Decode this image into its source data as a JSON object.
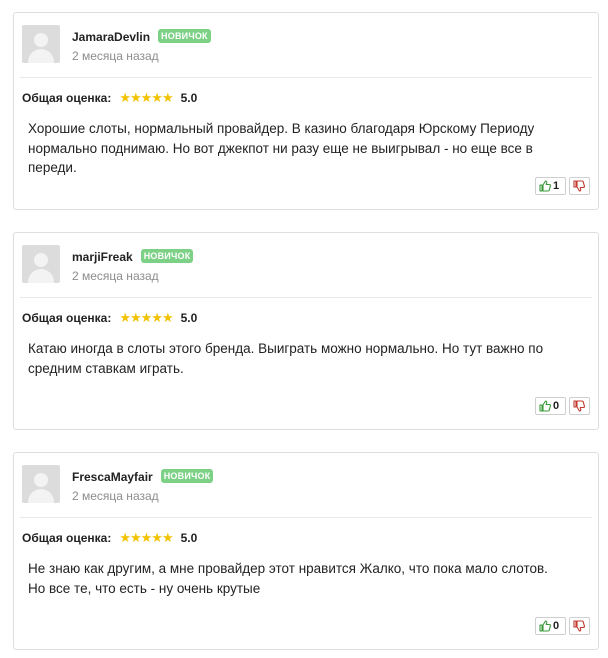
{
  "reviews": [
    {
      "username": "JamaraDevlin",
      "badge": "НОВИЧОК",
      "date": "2 месяца назад",
      "rating_label": "Общая оценка:",
      "stars": "★★★★★",
      "score": "5.0",
      "text": "Хорошие слоты, нормальный провайдер. В казино благодаря Юрскому Периоду нормально поднимаю. Но вот джекпот ни разу еще не выигрывал - но еще все в переди.",
      "likes": "1"
    },
    {
      "username": "marjiFreak",
      "badge": "НОВИЧОК",
      "date": "2 месяца назад",
      "rating_label": "Общая оценка:",
      "stars": "★★★★★",
      "score": "5.0",
      "text": "Катаю иногда в слоты этого бренда. Выиграть можно нормально. Но тут важно по средним ставкам играть.",
      "likes": "0"
    },
    {
      "username": "FrescaMayfair",
      "badge": "НОВИЧОК",
      "date": "2 месяца назад",
      "rating_label": "Общая оценка:",
      "stars": "★★★★★",
      "score": "5.0",
      "text": "Не знаю как другим, а мне провайдер этот нравится Жалко, что пока мало слотов. Но все те, что есть - ну очень крутые",
      "likes": "0"
    }
  ],
  "colors": {
    "badge": "#7dd186",
    "stars": "#f2c200",
    "like": "#3a9a3a",
    "dislike": "#c0392b"
  }
}
